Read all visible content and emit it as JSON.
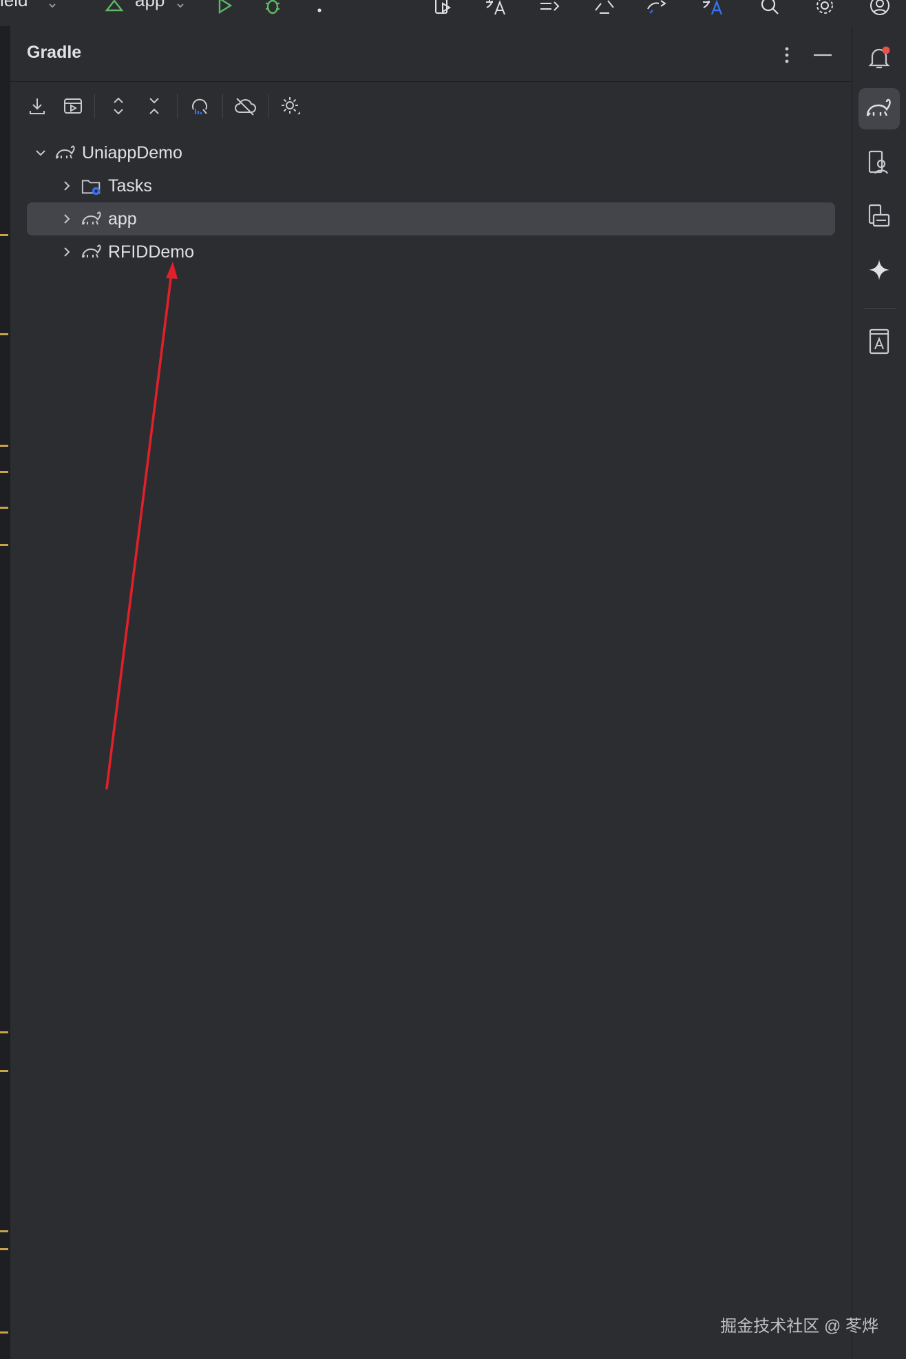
{
  "topbar": {
    "project_fragment": "ield",
    "run_config": "app",
    "icons": [
      "run-config-icon",
      "chevron-down-icon",
      "run-icon",
      "debug-icon",
      "more-icon",
      "device-mirror-icon",
      "translate-icon",
      "diff-icon",
      "sync-icon",
      "gradle-sync-icon",
      "ai-translate-icon",
      "search-icon",
      "settings-icon",
      "account-icon"
    ]
  },
  "panel": {
    "title": "Gradle",
    "toolbar": [
      "download-sources-icon",
      "run-task-icon",
      "expand-all-icon",
      "collapse-all-icon",
      "analyze-dependencies-icon",
      "offline-mode-icon",
      "gradle-settings-icon"
    ]
  },
  "tree": {
    "root": "UniappDemo",
    "children": [
      {
        "label": "Tasks",
        "icon": "tasks-folder-icon"
      },
      {
        "label": "app",
        "icon": "gradle-module-icon",
        "selected": true
      },
      {
        "label": "RFIDDemo",
        "icon": "gradle-module-icon"
      }
    ]
  },
  "right_strip": [
    "notifications-icon",
    "gradle-icon",
    "device-manager-icon",
    "running-devices-icon",
    "gemini-icon",
    "resource-manager-icon"
  ],
  "colors": {
    "background": "#2b2d30",
    "selection": "#43454a",
    "arrow": "#e0202a",
    "accent": "#3574f0",
    "gutter_mark": "#c9a24c"
  },
  "watermark": "掘金技术社区 @ 苳烨"
}
